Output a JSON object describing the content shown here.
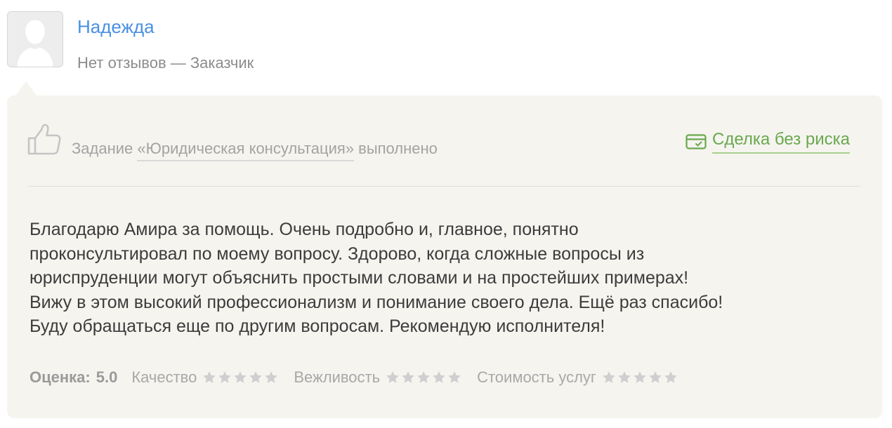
{
  "author": {
    "name": "Надежда",
    "meta": "Нет отзывов — Заказчик"
  },
  "review": {
    "task_prefix": "Задание ",
    "task_link": "«Юридическая консультация»",
    "task_suffix": " выполнено",
    "safe_deal": "Сделка без риска",
    "text_lines": [
      "Благодарю Амира за помощь. Очень подробно и, главное, понятно",
      "проконсультировал по моему вопросу. Здорово, когда сложные вопросы из",
      "юриспруденции могут объяснить простыми словами и на простейших примерах!",
      "Вижу в этом высокий профессионализм и понимание своего дела. Ещё раз спасибо!",
      "Буду обращаться еще по другим вопросам. Рекомендую исполнителя!"
    ],
    "score_label": "Оценка:",
    "score_value": "5.0",
    "criteria": [
      {
        "label": "Качество",
        "stars": 5
      },
      {
        "label": "Вежливость",
        "stars": 5
      },
      {
        "label": "Стоимость услуг",
        "stars": 5
      }
    ]
  },
  "icons": {
    "avatar": "user-silhouette-icon",
    "thumb": "thumbs-up-icon",
    "safe_deal": "credit-card-check-icon",
    "star": "star-icon"
  },
  "colors": {
    "link_blue": "#4a90e2",
    "safe_deal_green": "#6aa84f",
    "card_background": "#f5f4ef",
    "star_gray": "#cfcfcf"
  }
}
